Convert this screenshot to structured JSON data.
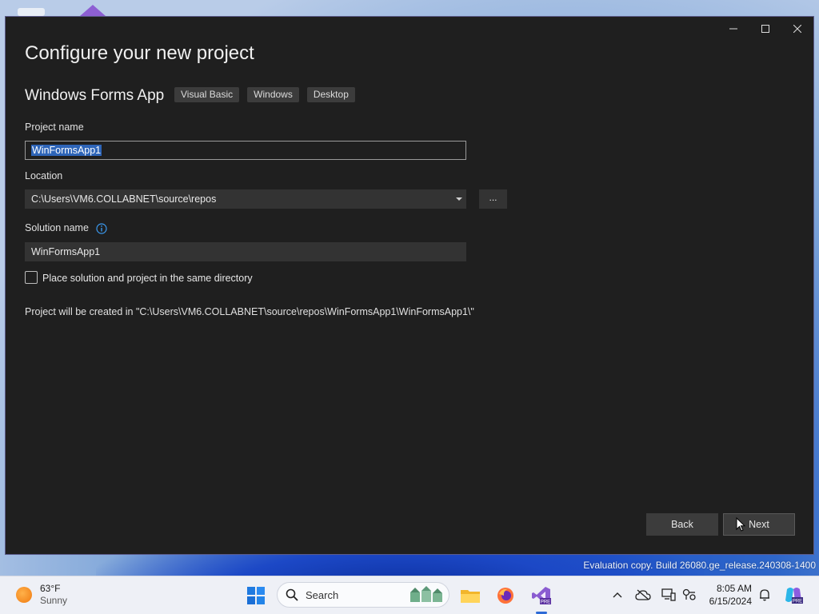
{
  "dialog": {
    "title": "Configure your new project",
    "template_name": "Windows Forms App",
    "tags": [
      "Visual Basic",
      "Windows",
      "Desktop"
    ],
    "project_name_label": "Project name",
    "project_name_value": "WinFormsApp1",
    "location_label": "Location",
    "location_value": "C:\\Users\\VM6.COLLABNET\\source\\repos",
    "browse_label": "...",
    "solution_name_label": "Solution name",
    "solution_name_value": "WinFormsApp1",
    "same_dir_label": "Place solution and project in the same directory",
    "same_dir_checked": false,
    "path_note": "Project will be created in \"C:\\Users\\VM6.COLLABNET\\source\\repos\\WinFormsApp1\\WinFormsApp1\\\"",
    "back_label": "Back",
    "next_label": "Next"
  },
  "desktop": {
    "watermark_line": "Evaluation copy. Build 26080.ge_release.240308-1400"
  },
  "taskbar": {
    "weather_temp": "63°F",
    "weather_condition": "Sunny",
    "search_placeholder": "Search",
    "time": "8:05 AM",
    "date": "6/15/2024",
    "apps": [
      "start-icon",
      "file-explorer-icon",
      "firefox-icon",
      "visual-studio-preview-icon"
    ],
    "tray_icons": [
      "chevron-up-icon",
      "cloud-offline-icon",
      "network-icon",
      "accessibility-icon",
      "notification-bell-icon",
      "copilot-icon"
    ]
  },
  "colors": {
    "window_bg": "#1f1f1f",
    "input_bg": "#333333",
    "selection": "#2e65b8",
    "taskbar_bg": "#eef0f6",
    "accent": "#2d6ad6"
  }
}
